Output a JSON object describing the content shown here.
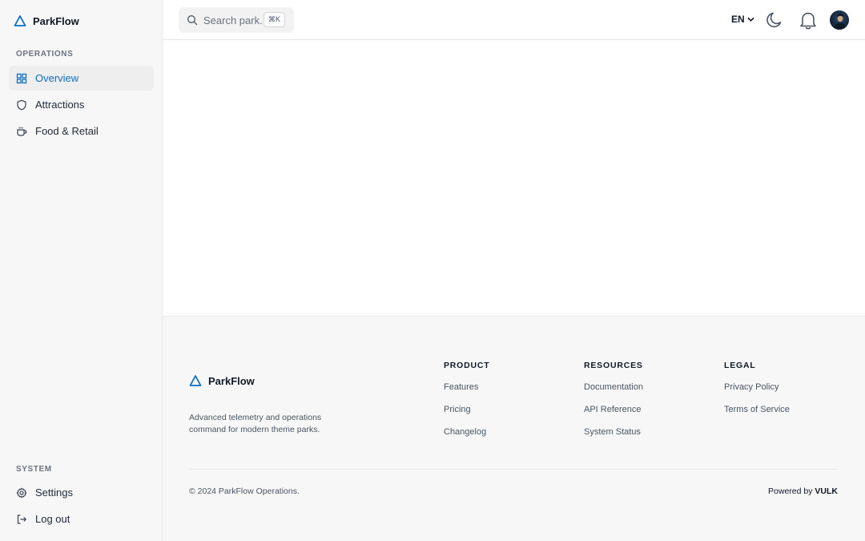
{
  "app": {
    "brand": "ParkFlow",
    "accent": "#0b6fc2"
  },
  "sidebar": {
    "operations_label": "OPERATIONS",
    "items": [
      {
        "label": "Overview",
        "icon": "grid-icon",
        "active": true
      },
      {
        "label": "Attractions",
        "icon": "shield-icon",
        "active": false
      },
      {
        "label": "Food & Retail",
        "icon": "coffee-cup-icon",
        "active": false
      }
    ],
    "system_label": "SYSTEM",
    "system_items": [
      {
        "label": "Settings",
        "icon": "gear-icon"
      },
      {
        "label": "Log out",
        "icon": "logout-icon"
      }
    ]
  },
  "topbar": {
    "search_placeholder": "Search park...",
    "search_shortcut": "⌘K",
    "language": "EN",
    "icons": [
      "moon-icon",
      "bell-icon",
      "avatar"
    ]
  },
  "footer": {
    "brand": "ParkFlow",
    "description": "Advanced telemetry and operations command for modern theme parks.",
    "columns": [
      {
        "title": "PRODUCT",
        "links": [
          "Features",
          "Pricing",
          "Changelog"
        ]
      },
      {
        "title": "RESOURCES",
        "links": [
          "Documentation",
          "API Reference",
          "System Status"
        ]
      },
      {
        "title": "LEGAL",
        "links": [
          "Privacy Policy",
          "Terms of Service"
        ]
      }
    ],
    "copyright": "© 2024 ParkFlow Operations.",
    "powered_prefix": "Powered by ",
    "powered_brand": "VULK"
  }
}
